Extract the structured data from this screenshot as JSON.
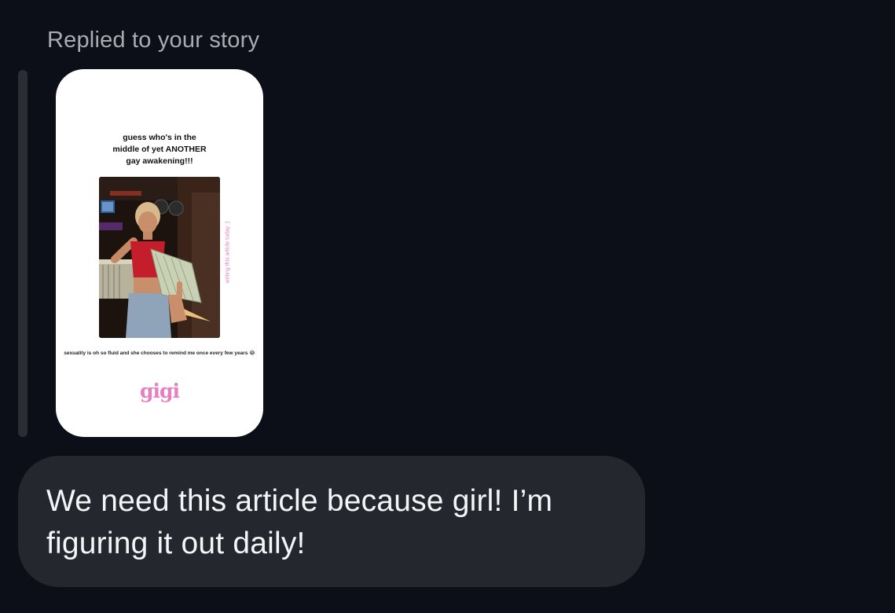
{
  "thread": {
    "reply_header": "Replied to your story"
  },
  "story": {
    "headline": "guess who's in the\nmiddle of yet ANOTHER\ngay awakening!!!",
    "side_text": "writing this article today :)",
    "caption": "sexuality is oh so fluid and she chooses to remind me once every few years 😂",
    "brand": "gigi",
    "photo_icon": "person-photo"
  },
  "message": {
    "text": "We need this article because girl! I’m figuring it out daily!"
  },
  "colors": {
    "background": "#0c0f17",
    "bubble": "#24272e",
    "accent_pink": "#e77ec4"
  }
}
